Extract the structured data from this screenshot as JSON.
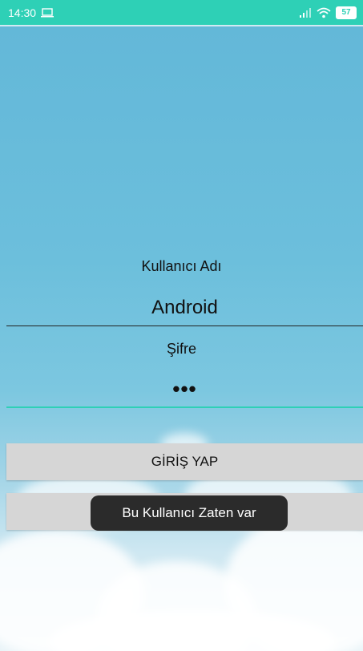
{
  "status_bar": {
    "time": "14:30",
    "battery": "57",
    "color": "#2ed0b6"
  },
  "form": {
    "username_label": "Kullanıcı Adı",
    "username_value": "Android",
    "password_label": "Şifre",
    "password_value": "•••"
  },
  "buttons": {
    "login_label": "GİRİŞ YAP",
    "second_label": ""
  },
  "toast": {
    "message": "Bu Kullanıcı Zaten var"
  }
}
